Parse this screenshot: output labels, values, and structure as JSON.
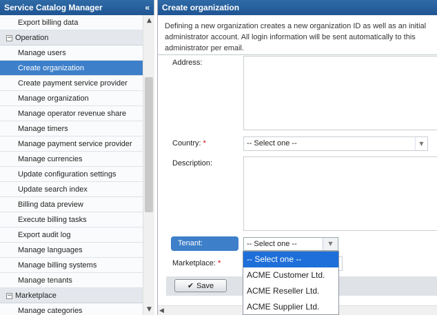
{
  "sidebar": {
    "title": "Service Catalog Manager",
    "collapse_icon": "«",
    "items": [
      {
        "type": "item",
        "label": "Export billing data",
        "active": false
      },
      {
        "type": "group",
        "label": "Operation",
        "toggle": "−"
      },
      {
        "type": "item",
        "label": "Manage users",
        "active": false
      },
      {
        "type": "item",
        "label": "Create organization",
        "active": true
      },
      {
        "type": "item",
        "label": "Create payment service provider",
        "active": false
      },
      {
        "type": "item",
        "label": "Manage organization",
        "active": false
      },
      {
        "type": "item",
        "label": "Manage operator revenue share",
        "active": false
      },
      {
        "type": "item",
        "label": "Manage timers",
        "active": false
      },
      {
        "type": "item",
        "label": "Manage payment service provider",
        "active": false
      },
      {
        "type": "item",
        "label": "Manage currencies",
        "active": false
      },
      {
        "type": "item",
        "label": "Update configuration settings",
        "active": false
      },
      {
        "type": "item",
        "label": "Update search index",
        "active": false
      },
      {
        "type": "item",
        "label": "Billing data preview",
        "active": false
      },
      {
        "type": "item",
        "label": "Execute billing tasks",
        "active": false
      },
      {
        "type": "item",
        "label": "Export audit log",
        "active": false
      },
      {
        "type": "item",
        "label": "Manage languages",
        "active": false
      },
      {
        "type": "item",
        "label": "Manage billing systems",
        "active": false
      },
      {
        "type": "item",
        "label": "Manage tenants",
        "active": false
      },
      {
        "type": "group",
        "label": "Marketplace",
        "toggle": "−"
      },
      {
        "type": "item",
        "label": "Manage categories",
        "active": false
      }
    ]
  },
  "main": {
    "title": "Create organization",
    "intro": "Defining a new organization creates a new organization ID as well as an initial administrator account. All login information will be sent automatically to this administrator per email."
  },
  "form": {
    "address_label": "Address:",
    "country_label": "Country:",
    "country_value": "-- Select one --",
    "description_label": "Description:",
    "tenant_label": "Tenant:",
    "tenant_value": "-- Select one --",
    "marketplace_label": "Marketplace:",
    "required_marker": "*",
    "save_label": "Save"
  },
  "tenant_dropdown": {
    "options": [
      "-- Select one --",
      "ACME Customer Ltd.",
      "ACME Reseller Ltd.",
      "ACME Supplier Ltd."
    ],
    "selected_index": 0
  },
  "colors": {
    "header": "#1f5592",
    "active": "#3d7fc9",
    "required": "#cc0000",
    "dropdown_selected": "#1e6fd9"
  }
}
